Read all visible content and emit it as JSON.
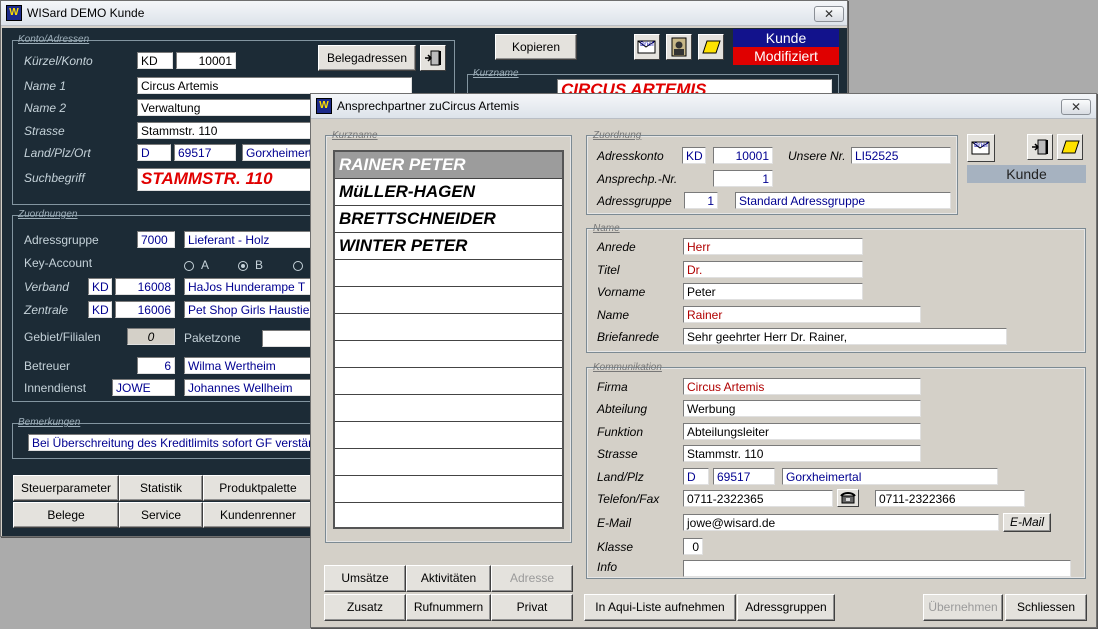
{
  "main_window": {
    "title": "WISard DEMO Kunde",
    "close": "✕",
    "konto_group": "Konto/Adressen",
    "kuerzel_label": "Kürzel/Konto",
    "kuerzel": "KD",
    "konto": "10001",
    "name1_label": "Name 1",
    "name1": "Circus Artemis",
    "name2_label": "Name 2",
    "name2": "Verwaltung",
    "strasse_label": "Strasse",
    "strasse": "Stammstr. 110",
    "land_label": "Land/Plz/Ort",
    "land": "D",
    "plz": "69517",
    "ort": "Gorxheimertal",
    "such_label": "Suchbegriff",
    "such": "STAMMSTR. 110",
    "belegadressen": "Belegadressen",
    "kopieren": "Kopieren",
    "kurzname_group": "Kurzname",
    "kurzname": "CIRCUS ARTEMIS",
    "status_kunde": "Kunde",
    "status_mod": "Modifiziert",
    "zuordnungen_group": "Zuordnungen",
    "adressgruppe_label": "Adressgruppe",
    "adressgruppe_nr": "7000",
    "adressgruppe": "Lieferant - Holz",
    "key_label": "Key-Account",
    "key_a": "A",
    "key_b": "B",
    "verband_label": "Verband",
    "verband_kz": "KD",
    "verband_nr": "16008",
    "verband": "HaJos Hunderampe T",
    "zentrale_label": "Zentrale",
    "zentrale_kz": "KD",
    "zentrale_nr": "16006",
    "zentrale": "Pet Shop Girls Haustier",
    "gebiet_label": "Gebiet/Filialen",
    "gebiet": "0",
    "paketzone_label": "Paketzone",
    "betreuer_label": "Betreuer",
    "betreuer_nr": "6",
    "betreuer": "Wilma Wertheim",
    "innendienst_label": "Innendienst",
    "innendienst_kz": "JOWE",
    "innendienst": "Johannes Wellheim",
    "bemerk_group": "Bemerkungen",
    "bemerk": "Bei Überschreitung des Kreditlimits sofort GF verständigen",
    "btns": [
      "Steuerparameter",
      "Statistik",
      "Produktpalette",
      "Belege",
      "Service",
      "Kundenrenner"
    ]
  },
  "dialog": {
    "title": "Ansprechpartner zuCircus Artemis",
    "close": "✕",
    "kurzname_group": "Kurzname",
    "contacts": [
      "RAINER PETER",
      "MüLLER-HAGEN",
      "BRETTSCHNEIDER",
      "WINTER PETER"
    ],
    "zuordnung_group": "Zuordnung",
    "adresskonto_label": "Adresskonto",
    "adresskonto_kz": "KD",
    "adresskonto": "10001",
    "unsere_label": "Unsere Nr.",
    "unsere": "LI52525",
    "ansprech_label": "Ansprechp.-Nr.",
    "ansprech": "1",
    "adressgruppe_label": "Adressgruppe",
    "adressgruppe_nr": "1",
    "adressgruppe": "Standard Adressgruppe",
    "kunde": "Kunde",
    "name_group": "Name",
    "anrede_label": "Anrede",
    "anrede": "Herr",
    "titel_label": "Titel",
    "titel": "Dr.",
    "vorname_label": "Vorname",
    "vorname": "Peter",
    "name_label": "Name",
    "name": "Rainer",
    "brief_label": "Briefanrede",
    "brief": "Sehr geehrter Herr Dr. Rainer,",
    "komm_group": "Kommunikation",
    "firma_label": "Firma",
    "firma": "Circus Artemis",
    "abteilung_label": "Abteilung",
    "abteilung": "Werbung",
    "funktion_label": "Funktion",
    "funktion": "Abteilungsleiter",
    "strasse_label": "Strasse",
    "strasse": "Stammstr. 110",
    "landplz_label": "Land/Plz",
    "land": "D",
    "plz": "69517",
    "ort": "Gorxheimertal",
    "tel_label": "Telefon/Fax",
    "tel": "0711-2322365",
    "fax": "0711-2322366",
    "email_label": "E-Mail",
    "email": "jowe@wisard.de",
    "email_btn": "E-Mail",
    "klasse_label": "Klasse",
    "klasse": "0",
    "info_label": "Info",
    "btn_umsaetze": "Umsätze",
    "btn_aktivitaeten": "Aktivitäten",
    "btn_adresse": "Adresse",
    "btn_zusatz": "Zusatz",
    "btn_rufnummern": "Rufnummern",
    "btn_privat": "Privat",
    "btn_aqui": "In Aqui-Liste aufnehmen",
    "btn_adressgruppen": "Adressgruppen",
    "btn_uebernehmen": "Übernehmen",
    "btn_schliessen": "Schliessen"
  }
}
